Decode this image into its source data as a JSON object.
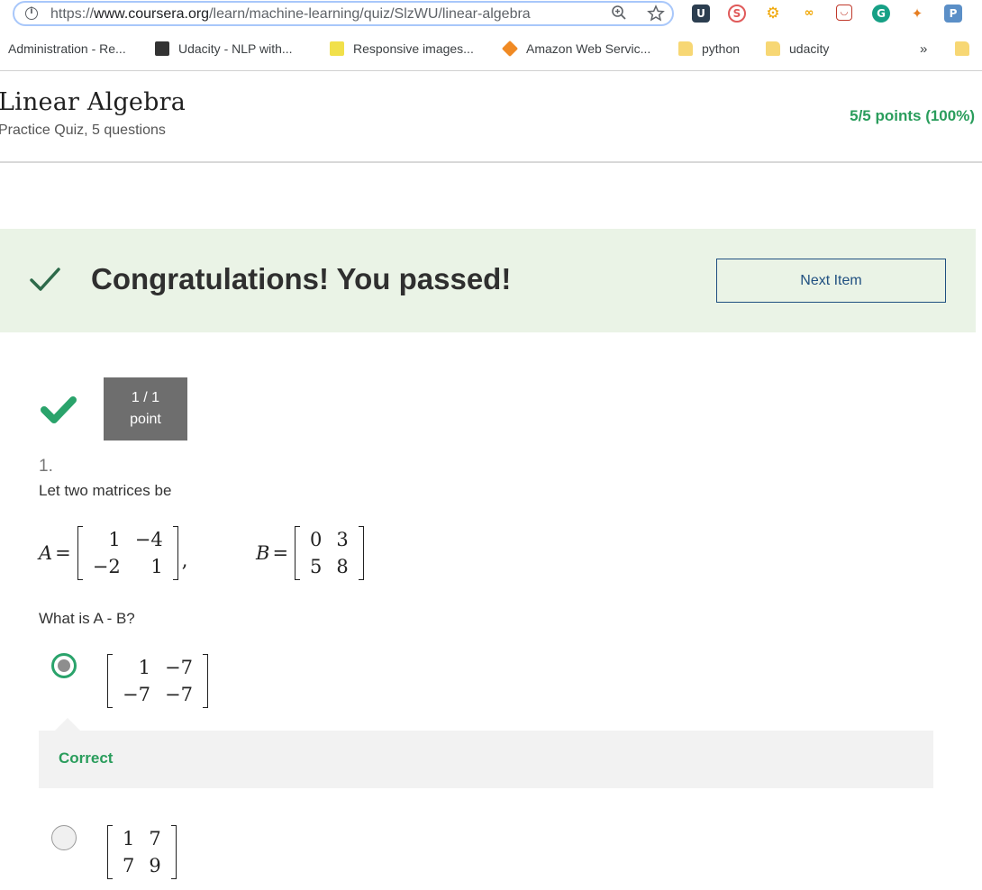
{
  "browser": {
    "url_prefix": "https://",
    "url_domain": "www.coursera.org",
    "url_path": "/learn/machine-learning/quiz/SlzWU/linear-algebra",
    "bookmarks": [
      {
        "label": "Administration - Re...",
        "icon": "page-icon"
      },
      {
        "label": "Udacity - NLP with...",
        "icon": "udacity-icon"
      },
      {
        "label": "Responsive images...",
        "icon": "butterfly-icon"
      },
      {
        "label": "Amazon Web Servic...",
        "icon": "aws-cube-icon"
      },
      {
        "label": "python",
        "icon": "folder-icon"
      },
      {
        "label": "udacity",
        "icon": "folder-icon"
      }
    ],
    "overflow_label": "»"
  },
  "header": {
    "title": "Linear Algebra",
    "subtitle": "Practice Quiz, 5 questions",
    "score": "5/5 points (100%)"
  },
  "banner": {
    "message": "Congratulations! You passed!",
    "next_button": "Next Item"
  },
  "question": {
    "points_line1": "1 / 1",
    "points_line2": "point",
    "number": "1.",
    "prompt": "Let two matrices be",
    "matrix_a_label": "A",
    "matrix_a": [
      [
        "1",
        "−4"
      ],
      [
        "−2",
        "1"
      ]
    ],
    "matrix_b_label": "B",
    "matrix_b": [
      [
        "0",
        "3"
      ],
      [
        "5",
        "8"
      ]
    ],
    "ask": "What is A - B?",
    "options": [
      {
        "matrix": [
          [
            "1",
            "−7"
          ],
          [
            "−7",
            "−7"
          ]
        ],
        "selected": true
      },
      {
        "matrix": [
          [
            "1",
            "7"
          ],
          [
            "7",
            "9"
          ]
        ],
        "selected": false
      }
    ],
    "feedback": "Correct"
  },
  "colors": {
    "success": "#2a9d5c",
    "banner_bg": "#eaf3e6",
    "link": "#1f4f80",
    "points_bg": "#6e6e6e"
  }
}
